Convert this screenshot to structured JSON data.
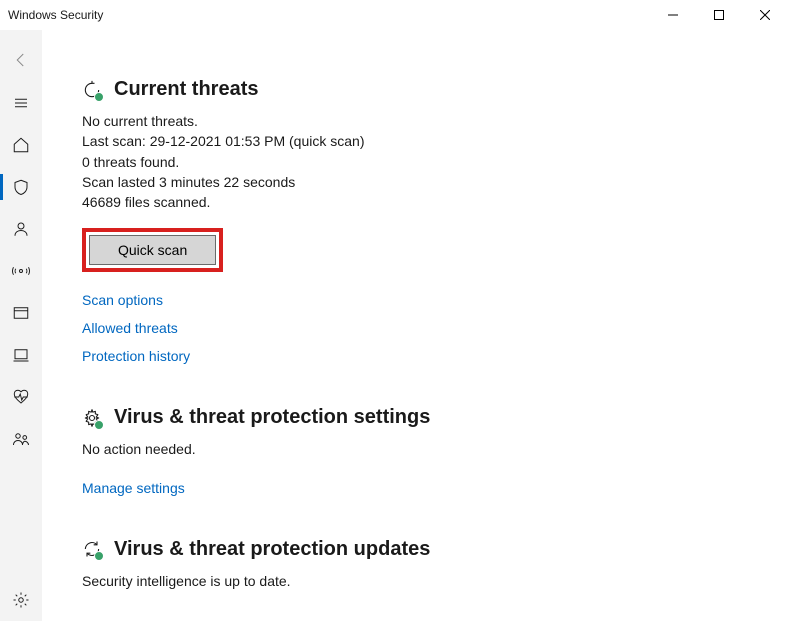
{
  "titlebar": {
    "title": "Windows Security"
  },
  "sections": {
    "threats": {
      "heading": "Current threats",
      "no_threats": "No current threats.",
      "last_scan": "Last scan: 29-12-2021 01:53 PM (quick scan)",
      "found": "0 threats found.",
      "duration": "Scan lasted 3 minutes 22 seconds",
      "files": "46689 files scanned.",
      "quick_scan_label": "Quick scan",
      "links": {
        "scan_options": "Scan options",
        "allowed_threats": "Allowed threats",
        "protection_history": "Protection history"
      }
    },
    "settings": {
      "heading": "Virus & threat protection settings",
      "status": "No action needed.",
      "links": {
        "manage": "Manage settings"
      }
    },
    "updates": {
      "heading": "Virus & threat protection updates",
      "status": "Security intelligence is up to date."
    }
  }
}
